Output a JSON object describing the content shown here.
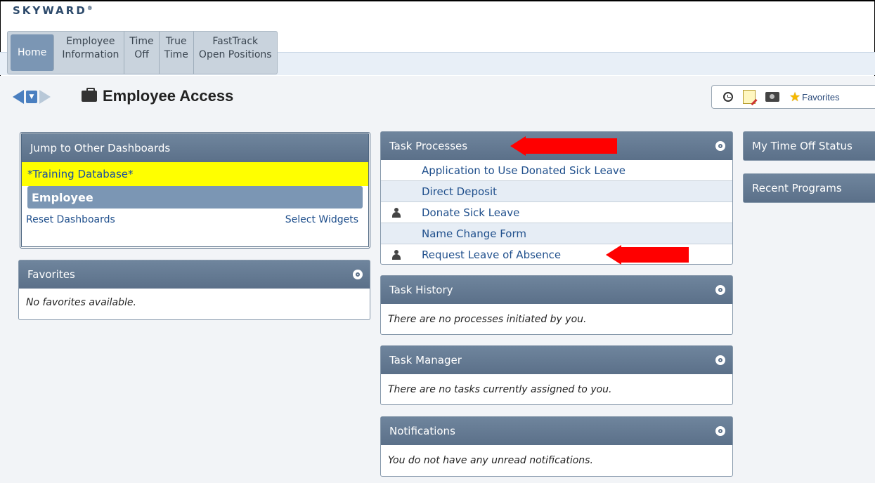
{
  "brand": {
    "logo_text": "SKYWARD",
    "logo_mark": "®"
  },
  "nav": {
    "tabs": [
      {
        "label": "Home"
      },
      {
        "label": "Employee\nInformation"
      },
      {
        "label": "Time\nOff"
      },
      {
        "label": "True\nTime"
      },
      {
        "label": "FastTrack\nOpen Positions"
      }
    ]
  },
  "header": {
    "title": "Employee Access",
    "favorites_label": "Favorites"
  },
  "jump": {
    "title": "Jump to Other Dashboards",
    "training": "*Training Database*",
    "employee": "Employee",
    "reset": "Reset Dashboards",
    "select": "Select Widgets"
  },
  "favorites": {
    "title": "Favorites",
    "empty": "No favorites available."
  },
  "task_processes": {
    "title": "Task Processes",
    "items": [
      {
        "label": "Application to Use Donated Sick Leave"
      },
      {
        "label": "Direct Deposit"
      },
      {
        "label": "Donate Sick Leave"
      },
      {
        "label": "Name Change Form"
      },
      {
        "label": "Request Leave of Absence"
      }
    ]
  },
  "task_history": {
    "title": "Task History",
    "empty": "There are no processes initiated by you."
  },
  "task_manager": {
    "title": "Task Manager",
    "empty": "There are no tasks currently assigned to you."
  },
  "notifications": {
    "title": "Notifications",
    "empty": "You do not have any unread notifications."
  },
  "right": {
    "time_off": "My Time Off Status",
    "recent": "Recent Programs"
  },
  "colors": {
    "annotation_arrow": "#ff0000",
    "training_highlight": "#ffff00",
    "panel_header": "#5b7089"
  }
}
